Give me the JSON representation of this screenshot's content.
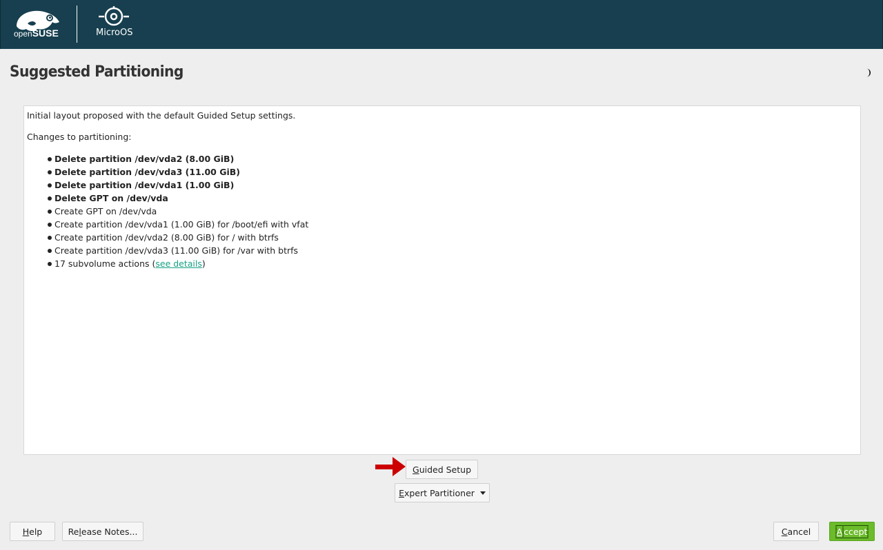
{
  "header": {
    "brand_open": "open",
    "brand_suse": "SUSE",
    "product_name": "MicroOS"
  },
  "page": {
    "title": "Suggested Partitioning"
  },
  "proposal": {
    "intro": "Initial layout proposed with the default Guided Setup settings.",
    "changes_heading": "Changes to partitioning:",
    "changes": [
      {
        "text": "Delete partition /dev/vda2 (8.00 GiB)",
        "bold": true
      },
      {
        "text": "Delete partition /dev/vda3 (11.00 GiB)",
        "bold": true
      },
      {
        "text": "Delete partition /dev/vda1 (1.00 GiB)",
        "bold": true
      },
      {
        "text": "Delete GPT on /dev/vda",
        "bold": true
      },
      {
        "text": "Create GPT on /dev/vda",
        "bold": false
      },
      {
        "text": "Create partition /dev/vda1 (1.00 GiB) for /boot/efi with vfat",
        "bold": false
      },
      {
        "text": "Create partition /dev/vda2 (8.00 GiB) for / with btrfs",
        "bold": false
      },
      {
        "text": "Create partition /dev/vda3 (11.00 GiB) for /var with btrfs",
        "bold": false
      }
    ],
    "subvolume_prefix": "17 subvolume actions (",
    "subvolume_link": "see details",
    "subvolume_suffix": ")"
  },
  "actions": {
    "guided_setup_label_u": "G",
    "guided_setup_label_rest": "uided Setup",
    "expert_label_u": "E",
    "expert_label_rest": "xpert Partitioner"
  },
  "footer": {
    "help_u": "H",
    "help_rest": "elp",
    "release_pre": "Re",
    "release_u": "l",
    "release_rest": "ease Notes...",
    "cancel_u": "C",
    "cancel_rest": "ancel",
    "accept_u": "A",
    "accept_rest": "ccept"
  },
  "colors": {
    "header_bg": "#173f4f",
    "accept_bg": "#6bbb2a",
    "link": "#16a085",
    "annotation_arrow": "#cc0000"
  },
  "icons": {
    "brand": "opensuse-chameleon-logo",
    "product": "microos-logo",
    "theme": "half-moon-icon",
    "annotation": "red-arrow-icon"
  }
}
